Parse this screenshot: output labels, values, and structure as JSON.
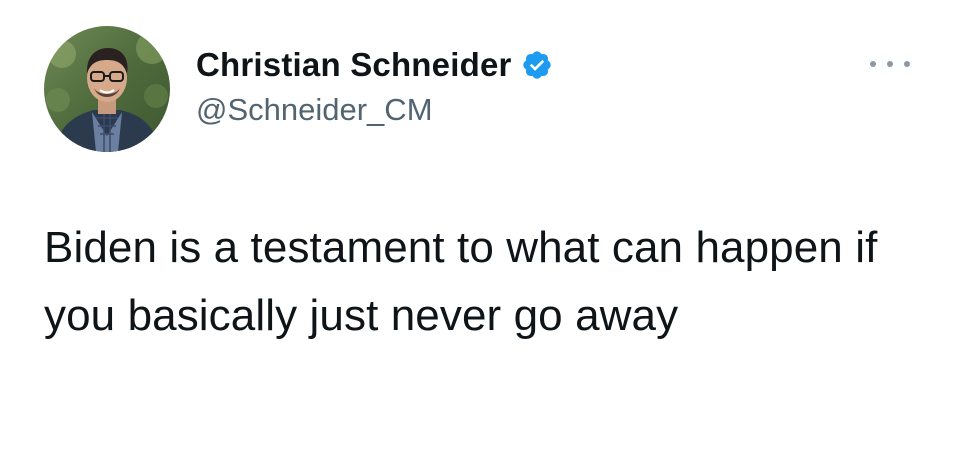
{
  "tweet": {
    "author": {
      "display_name": "Christian Schneider",
      "handle": "@Schneider_CM",
      "verified": true,
      "verified_icon": "verified-badge-icon",
      "avatar_icon": "profile-photo"
    },
    "text": "Biden is a testament to what can happen if you basically just never go away",
    "more_icon": "more-options-icon"
  },
  "colors": {
    "text": "#0f1419",
    "secondary_text": "#536471",
    "verified_blue": "#1d9bf0",
    "more_dots": "#8b98a5"
  }
}
